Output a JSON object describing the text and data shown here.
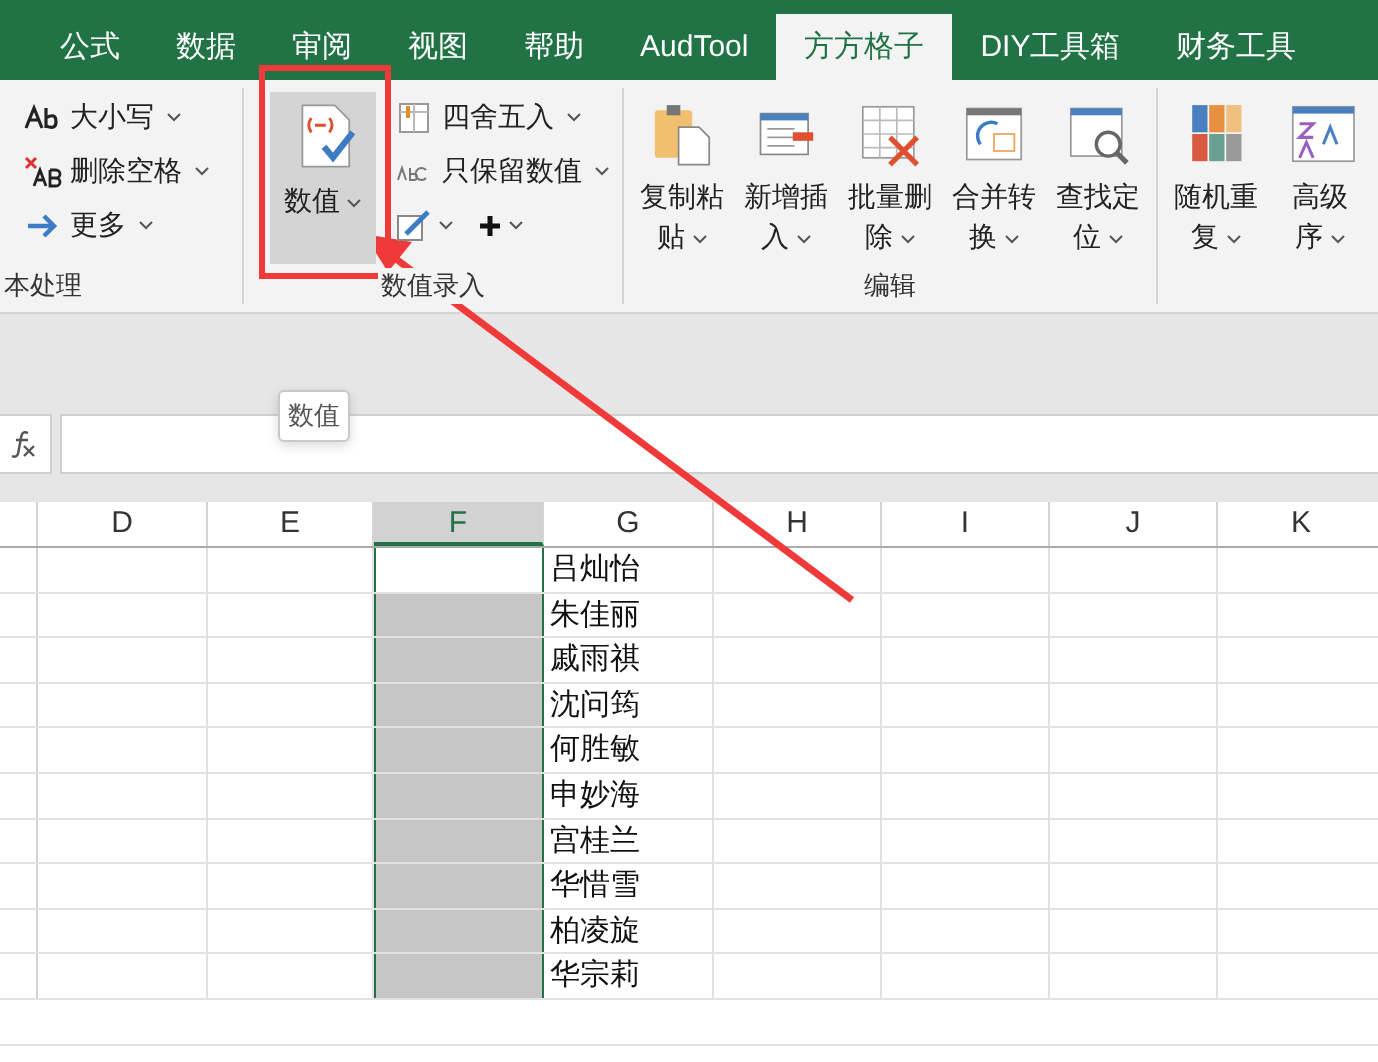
{
  "tabs": [
    {
      "label": "公式",
      "selected": false
    },
    {
      "label": "数据",
      "selected": false
    },
    {
      "label": "审阅",
      "selected": false
    },
    {
      "label": "视图",
      "selected": false
    },
    {
      "label": "帮助",
      "selected": false
    },
    {
      "label": "AudTool",
      "selected": false
    },
    {
      "label": "方方格子",
      "selected": true
    },
    {
      "label": "DIY工具箱",
      "selected": false
    },
    {
      "label": "财务工具",
      "selected": false
    }
  ],
  "groups": [
    {
      "label": "本处理",
      "small": [
        {
          "kind": "case",
          "label": "大小写"
        },
        {
          "kind": "trim",
          "label": "删除空格"
        },
        {
          "kind": "more",
          "label": "更多"
        }
      ]
    },
    {
      "label": "数值录入",
      "big": [
        {
          "kind": "number",
          "lines": [
            "数值"
          ],
          "highlighted": true
        }
      ],
      "small": [
        {
          "kind": "round",
          "label": "四舍五入"
        },
        {
          "kind": "keep",
          "label": "只保留数值"
        },
        {
          "kind": "tools"
        }
      ]
    },
    {
      "label": "编辑",
      "big": [
        {
          "kind": "paste",
          "lines": [
            "复制粘",
            "贴"
          ],
          "highlighted": false
        },
        {
          "kind": "insert",
          "lines": [
            "新增插",
            "入"
          ],
          "highlighted": false
        },
        {
          "kind": "delete",
          "lines": [
            "批量删",
            "除"
          ],
          "highlighted": false
        },
        {
          "kind": "merge",
          "lines": [
            "合并转",
            "换"
          ],
          "highlighted": false
        },
        {
          "kind": "find",
          "lines": [
            "查找定",
            "位"
          ],
          "highlighted": false
        }
      ]
    },
    {
      "big": [
        {
          "kind": "shuffle",
          "lines": [
            "随机重",
            "复"
          ],
          "highlighted": false
        },
        {
          "kind": "sort",
          "lines": [
            "高级",
            "序"
          ],
          "highlighted": false
        }
      ]
    }
  ],
  "tooltip": "数值",
  "columns": [
    {
      "label": "D",
      "selected": false
    },
    {
      "label": "E",
      "selected": false
    },
    {
      "label": "F",
      "selected": true
    },
    {
      "label": "G",
      "selected": false
    },
    {
      "label": "H",
      "selected": false
    },
    {
      "label": "I",
      "selected": false
    },
    {
      "label": "J",
      "selected": false
    },
    {
      "label": "K",
      "selected": false
    }
  ],
  "rows": [
    {
      "g": "吕灿怡",
      "f_selected": true,
      "active": true
    },
    {
      "g": "朱佳丽",
      "f_selected": true,
      "active": false
    },
    {
      "g": "戚雨祺",
      "f_selected": true,
      "active": false
    },
    {
      "g": "沈问筠",
      "f_selected": true,
      "active": false
    },
    {
      "g": "何胜敏",
      "f_selected": true,
      "active": false
    },
    {
      "g": "申妙海",
      "f_selected": true,
      "active": false
    },
    {
      "g": "宫桂兰",
      "f_selected": true,
      "active": false
    },
    {
      "g": "华惜雪",
      "f_selected": true,
      "active": false
    },
    {
      "g": "柏凌旋",
      "f_selected": true,
      "active": false
    },
    {
      "g": "华宗莉",
      "f_selected": true,
      "active": false
    }
  ]
}
